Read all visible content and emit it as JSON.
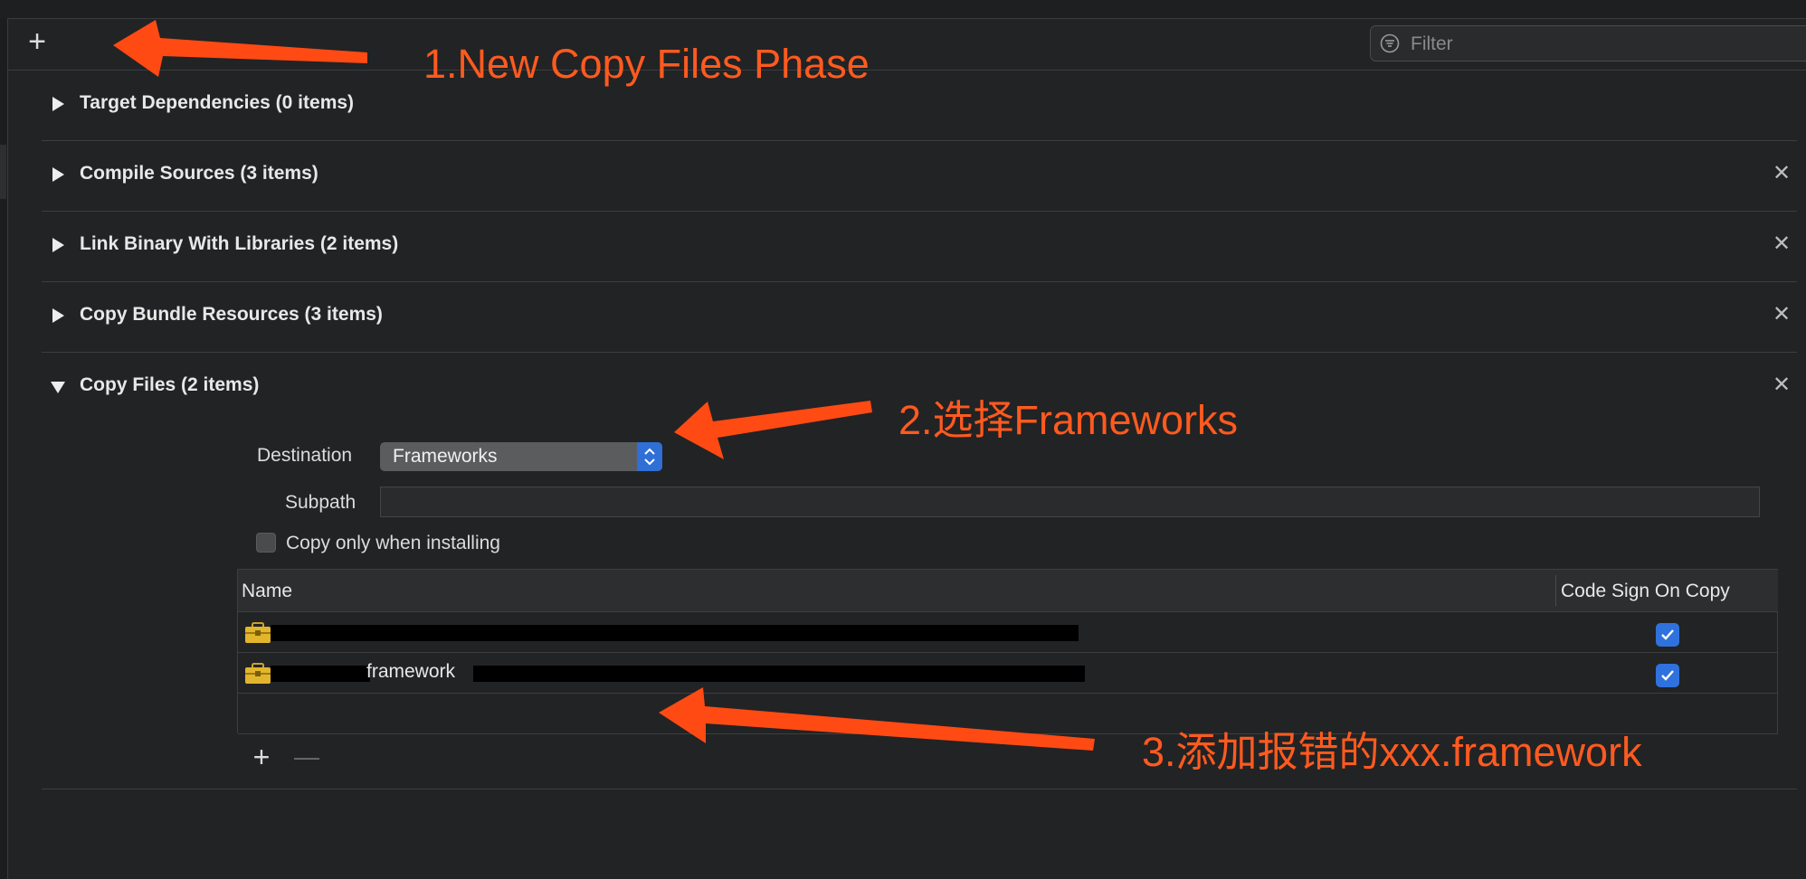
{
  "toolbar": {
    "add_symbol": "+",
    "filter_placeholder": "Filter"
  },
  "phases": [
    {
      "title": "Target Dependencies (0 items)",
      "expanded": false,
      "closable": false
    },
    {
      "title": "Compile Sources (3 items)",
      "expanded": false,
      "closable": true
    },
    {
      "title": "Link Binary With Libraries (2 items)",
      "expanded": false,
      "closable": true
    },
    {
      "title": "Copy Bundle Resources (3 items)",
      "expanded": false,
      "closable": true
    },
    {
      "title": "Copy Files (2 items)",
      "expanded": true,
      "closable": true
    }
  ],
  "close_symbol": "✕",
  "copy_files": {
    "destination_label": "Destination",
    "destination_value": "Frameworks",
    "subpath_label": "Subpath",
    "subpath_value": "",
    "copy_only_label": "Copy only when installing",
    "copy_only_checked": false,
    "table": {
      "columns": [
        "Name",
        "Code Sign On Copy"
      ],
      "rows": [
        {
          "name_visible": "",
          "redacted": true,
          "code_sign": true,
          "icon": "framework-toolbox-icon"
        },
        {
          "name_visible": "framework",
          "redacted": true,
          "code_sign": true,
          "icon": "framework-toolbox-icon"
        }
      ]
    },
    "add_symbol": "+",
    "remove_symbol": "—"
  },
  "annotations": [
    "1.New Copy Files Phase",
    "2.选择Frameworks",
    "3.添加报错的xxx.framework"
  ],
  "colors": {
    "background": "#222324",
    "annotation": "#ff5a1f",
    "accent": "#2f72dd"
  }
}
